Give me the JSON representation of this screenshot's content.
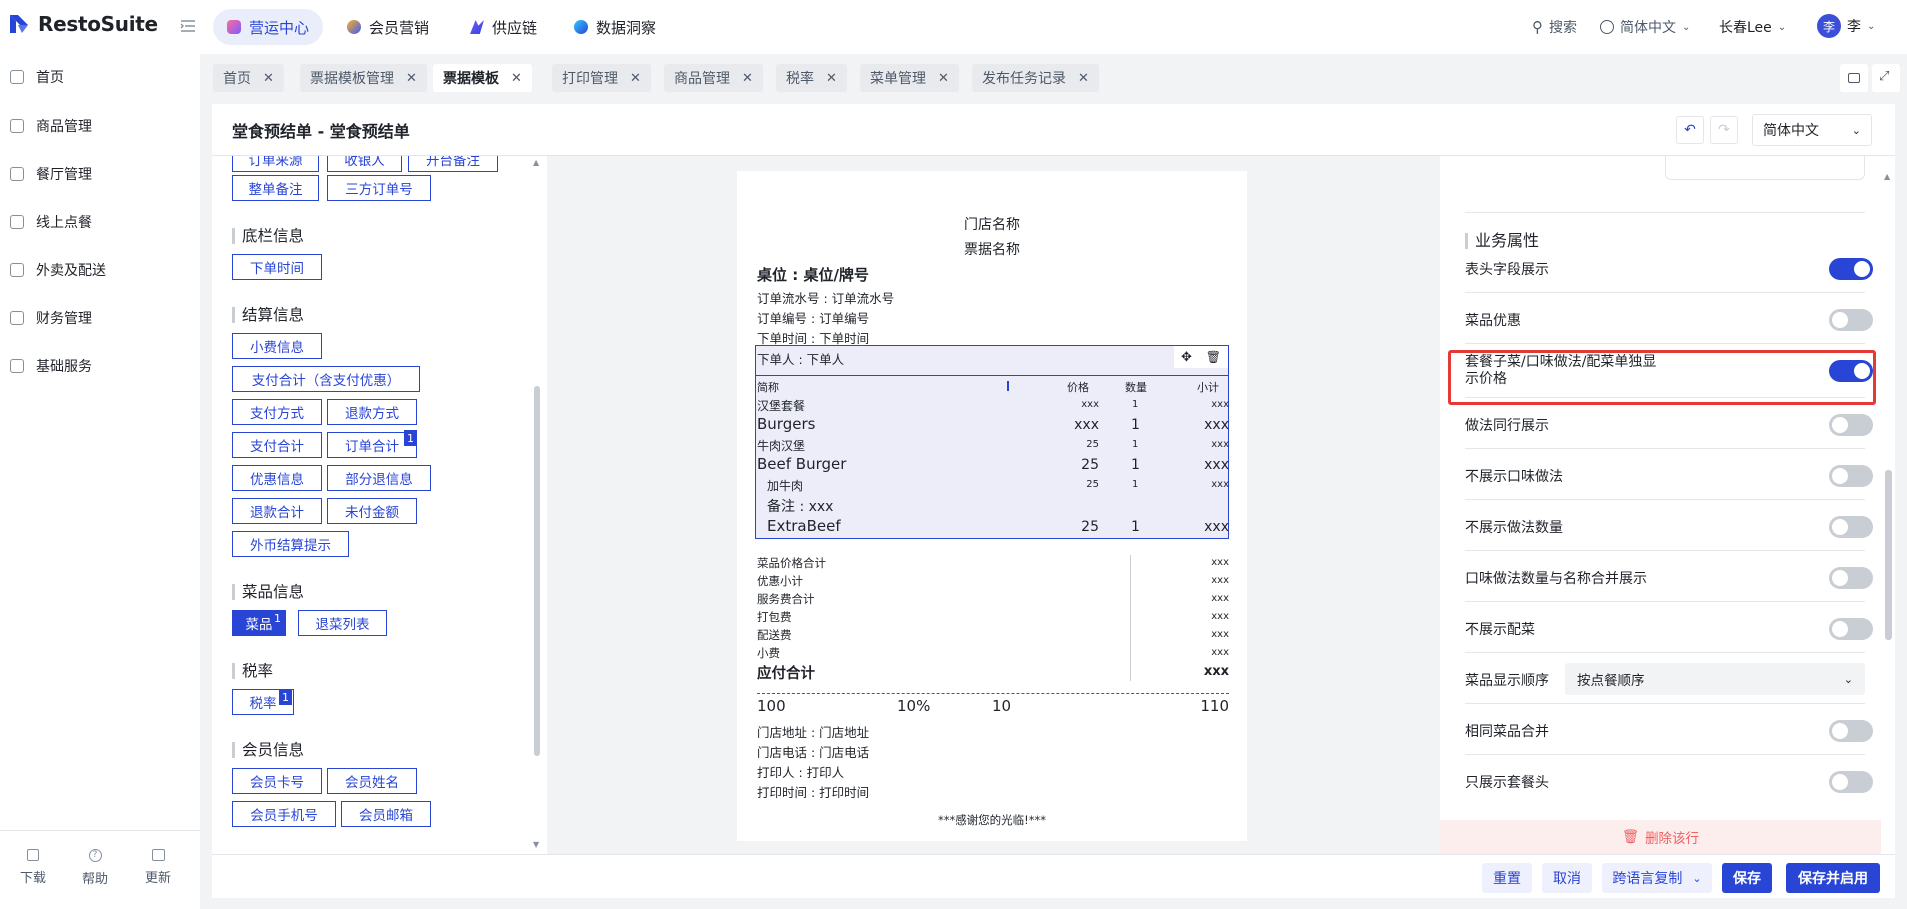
{
  "brand": {
    "name": "RestoSuite",
    "accent": "#2945d6",
    "highlight": "#e53935"
  },
  "topnav": [
    {
      "label": "营运中心",
      "icon": "ops-icon",
      "active": true
    },
    {
      "label": "会员营销",
      "icon": "member-icon"
    },
    {
      "label": "供应链",
      "icon": "supply-icon"
    },
    {
      "label": "数据洞察",
      "icon": "insight-icon"
    }
  ],
  "topright": {
    "search": "搜索",
    "language": "简体中文",
    "store": "长春Lee",
    "user_initial": "李",
    "user_name": "李"
  },
  "sidebar": {
    "items": [
      {
        "label": "首页",
        "icon": "home-icon"
      },
      {
        "label": "商品管理",
        "icon": "box-icon"
      },
      {
        "label": "餐厅管理",
        "icon": "store-icon"
      },
      {
        "label": "线上点餐",
        "icon": "mobile-icon"
      },
      {
        "label": "外卖及配送",
        "icon": "bag-icon"
      },
      {
        "label": "财务管理",
        "icon": "wallet-icon"
      },
      {
        "label": "基础服务",
        "icon": "grid-icon"
      }
    ],
    "bottom": [
      {
        "label": "下载",
        "icon": "download-icon"
      },
      {
        "label": "帮助",
        "icon": "help-icon"
      },
      {
        "label": "更新",
        "icon": "update-icon"
      }
    ]
  },
  "tabs": [
    {
      "label": "首页",
      "active": false
    },
    {
      "label": "票据模板管理",
      "active": false
    },
    {
      "label": "票据模板",
      "active": true
    },
    {
      "label": "打印管理",
      "active": false
    },
    {
      "label": "商品管理",
      "active": false
    },
    {
      "label": "税率",
      "active": false
    },
    {
      "label": "菜单管理",
      "active": false
    },
    {
      "label": "发布任务记录",
      "active": false
    }
  ],
  "header": {
    "title": "堂食预结单 - 堂食预结单",
    "language": "简体中文"
  },
  "left": {
    "partial_top": [
      "订单来源",
      "收银人",
      "开台备注"
    ],
    "top_chips": [
      "整单备注",
      "三方订单号"
    ],
    "sections": [
      {
        "title": "底栏信息",
        "chips": [
          "下单时间"
        ]
      },
      {
        "title": "结算信息",
        "chips": [
          "小费信息",
          "支付合计（含支付优惠）",
          "支付方式",
          "退款方式",
          "支付合计",
          "订单合计",
          "优惠信息",
          "部分退信息",
          "退款合计",
          "未付金额",
          "外币结算提示"
        ]
      },
      {
        "title": "菜品信息",
        "chips": [
          "菜品",
          "退菜列表"
        ]
      },
      {
        "title": "税率",
        "chips": [
          "税率"
        ]
      },
      {
        "title": "会员信息",
        "chips": [
          "会员卡号",
          "会员姓名",
          "会员手机号",
          "会员邮箱"
        ]
      }
    ],
    "badge": "1"
  },
  "receipt": {
    "store_name": "门店名称",
    "receipt_name": "票据名称",
    "table": "桌位 : 桌位/牌号",
    "serial": "订单流水号 : 订单流水号",
    "order_no": "订单编号 : 订单编号",
    "order_time": "下单时间 : 下单时间",
    "orderer": "下单人 : 下单人",
    "columns": [
      "简称",
      "价格",
      "数量",
      "小计"
    ],
    "items": [
      {
        "name": "汉堡套餐",
        "price": "xxx",
        "qty": "1",
        "sub": "xxx"
      },
      {
        "name": "Burgers",
        "price": "xxx",
        "qty": "1",
        "sub": "xxx"
      },
      {
        "name": "牛肉汉堡",
        "price": "25",
        "qty": "1",
        "sub": "xxx"
      },
      {
        "name": "Beef Burger",
        "price": "25",
        "qty": "1",
        "sub": "xxx"
      },
      {
        "name": "加牛肉",
        "price": "25",
        "qty": "1",
        "sub": "xxx"
      },
      {
        "name": "备注 : xxx",
        "price": "",
        "qty": "",
        "sub": ""
      },
      {
        "name": "ExtraBeef",
        "price": "25",
        "qty": "1",
        "sub": "xxx"
      }
    ],
    "totals": [
      {
        "label": "菜品价格合计",
        "value": "xxx"
      },
      {
        "label": "优惠小计",
        "value": "xxx"
      },
      {
        "label": "服务费合计",
        "value": "xxx"
      },
      {
        "label": "打包费",
        "value": "xxx"
      },
      {
        "label": "配送费",
        "value": "xxx"
      },
      {
        "label": "小费",
        "value": "xxx"
      }
    ],
    "payable": {
      "label": "应付合计",
      "value": "xxx"
    },
    "tax_row": [
      "100",
      "10%",
      "10",
      "110"
    ],
    "address": "门店地址 : 门店地址",
    "phone": "门店电话 : 门店电话",
    "printer": "打印人 : 打印人",
    "print_time": "打印时间 : 打印时间",
    "thanks": "***感谢您的光临!***"
  },
  "right": {
    "section_title": "业务属性",
    "rows": [
      {
        "label": "表头字段展示",
        "on": true
      },
      {
        "label": "菜品优惠",
        "on": false
      },
      {
        "label": "套餐子菜/口味做法/配菜单独显示价格",
        "on": true,
        "highlight": true
      },
      {
        "label": "做法同行展示",
        "on": false
      },
      {
        "label": "不展示口味做法",
        "on": false
      },
      {
        "label": "不展示做法数量",
        "on": false
      },
      {
        "label": "口味做法数量与名称合并展示",
        "on": false
      },
      {
        "label": "不展示配菜",
        "on": false
      },
      {
        "label": "菜品显示顺序",
        "select": "按点餐顺序"
      },
      {
        "label": "相同菜品合并",
        "on": false
      },
      {
        "label": "只展示套餐头",
        "on": false
      }
    ],
    "delete_row": "删除该行"
  },
  "footer": {
    "reset": "重置",
    "cancel": "取消",
    "copy": "跨语言复制",
    "save": "保存",
    "save_enable": "保存并启用"
  }
}
